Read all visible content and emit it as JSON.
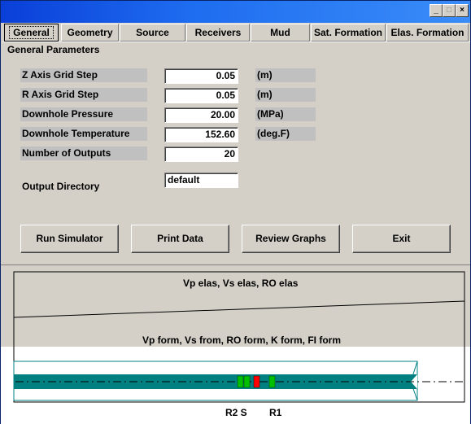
{
  "window": {
    "controls": {
      "minimize": "_",
      "maximize": "□",
      "close": "×"
    }
  },
  "tabs": [
    {
      "label": "General",
      "active": true
    },
    {
      "label": "Geometry",
      "active": false
    },
    {
      "label": "Source",
      "active": false
    },
    {
      "label": "Receivers",
      "active": false
    },
    {
      "label": "Mud",
      "active": false
    },
    {
      "label": "Sat. Formation",
      "active": false
    },
    {
      "label": "Elas. Formation",
      "active": false
    }
  ],
  "general": {
    "group_title": "General Parameters",
    "params": [
      {
        "label": "Z Axis Grid Step",
        "value": "0.05",
        "unit": "(m)"
      },
      {
        "label": "R Axis Grid Step",
        "value": "0.05",
        "unit": "(m)"
      },
      {
        "label": "Downhole Pressure",
        "value": "20.00",
        "unit": "(MPa)"
      },
      {
        "label": "Downhole Temperature",
        "value": "152.60",
        "unit": "(deg.F)"
      },
      {
        "label": "Number of Outputs",
        "value": "20",
        "unit": ""
      }
    ],
    "output_directory": {
      "label": "Output Directory",
      "value": "default"
    }
  },
  "buttons": {
    "run": "Run Simulator",
    "print": "Print Data",
    "review": "Review Graphs",
    "exit": "Exit"
  },
  "graph": {
    "elas_label": "Vp elas, Vs elas, RO elas",
    "form_label": "Vp form, Vs from, RO form, K form, FI form",
    "receivers_label": "R2 S",
    "receiver1_label": "R1",
    "colors": {
      "elas_zone": "#d4d0c8",
      "tool": "#008080",
      "receiver": "#00c000",
      "source": "#ff0000",
      "border": "#000000"
    }
  }
}
